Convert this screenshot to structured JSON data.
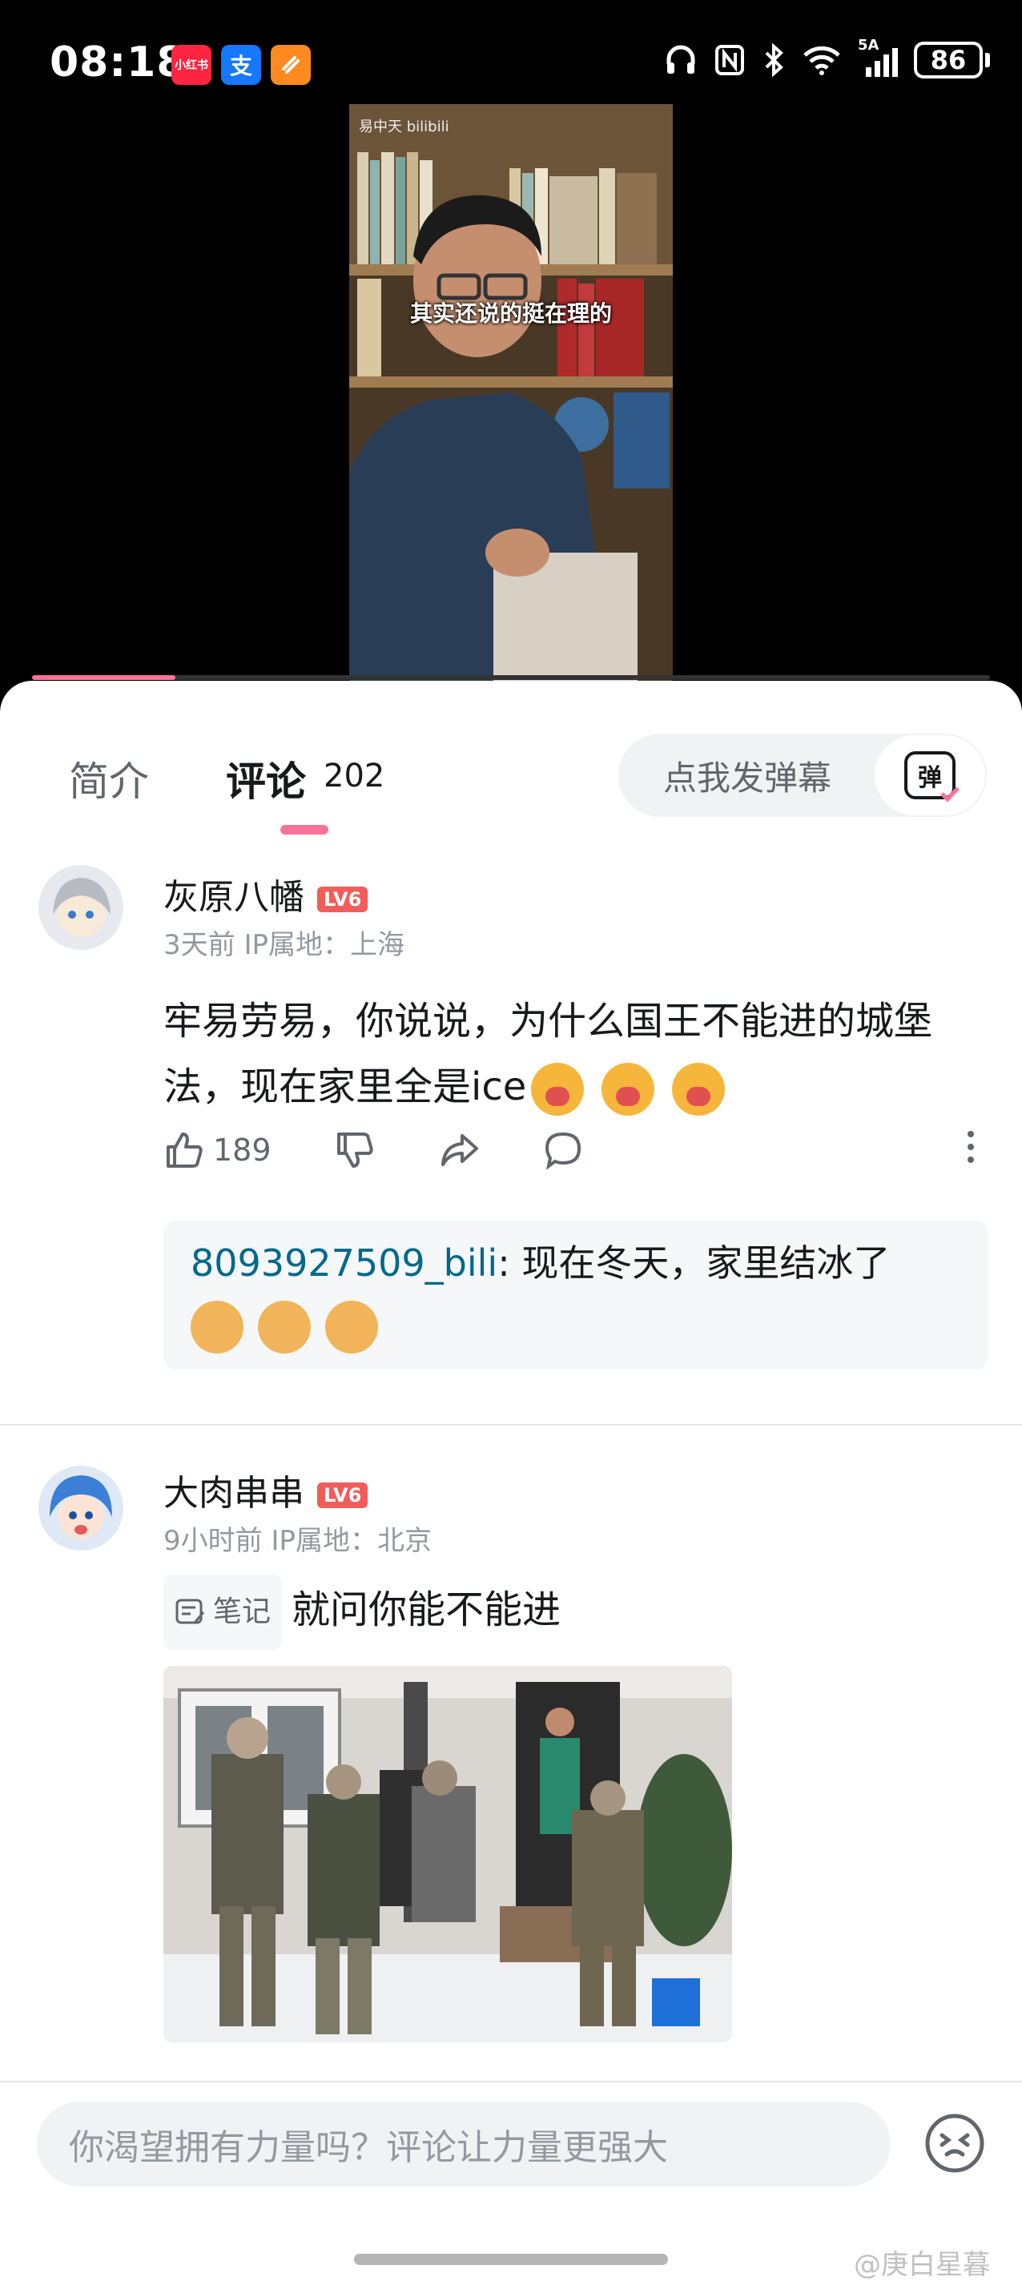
{
  "status_bar": {
    "time": "08:18",
    "network": "5A",
    "battery": "86",
    "apps": [
      {
        "name": "xiaohongshu-icon",
        "label": "小红书",
        "color": "#ff2442"
      },
      {
        "name": "alipay-icon",
        "label": "支",
        "color": "#1677ff"
      },
      {
        "name": "app-icon",
        "label": "",
        "color": "#ff8a1f"
      }
    ]
  },
  "video": {
    "watermark": "易中天 bilibili",
    "subtitle": "其实还说的挺在理的",
    "progress": 0.15
  },
  "tabs": {
    "intro": "简介",
    "comments": "评论",
    "comment_count": "202",
    "danmaku_placeholder": "点我发弹幕",
    "danmaku_icon_label": "弹"
  },
  "comments": [
    {
      "username": "灰原八幡",
      "level": "LV6",
      "meta": "3天前 IP属地：上海",
      "text": "牢易劳易，你说说，为什么国王不能进的城堡法，现在家里全是ice",
      "likes": "189",
      "reply": {
        "user": "8093927509_bili",
        "text": ": 现在冬天，家里结冰了"
      }
    },
    {
      "username": "大肉串串",
      "level": "LV6",
      "meta": "9小时前 IP属地：北京",
      "note_tag": "笔记",
      "text": "就问你能不能进"
    }
  ],
  "bottom_bar": {
    "placeholder": "你渴望拥有力量吗？评论让力量更强大",
    "watermark": "@庚白星暮"
  },
  "colors": {
    "accent": "#fb7299",
    "level_badge": "#f25d59",
    "reply_link": "#00698c"
  }
}
